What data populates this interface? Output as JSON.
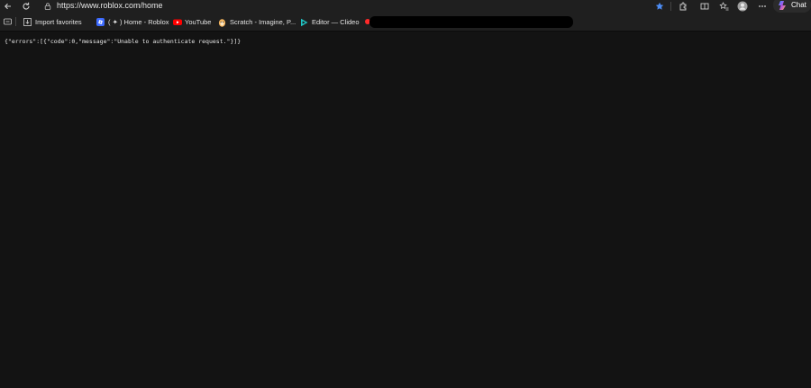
{
  "browser": {
    "address_bar": {
      "url": "https://www.roblox.com/home"
    },
    "chat_label": "Chat"
  },
  "bookmarks": {
    "items": [
      {
        "label": "Import favorites",
        "icon": "folder-import-icon"
      },
      {
        "label": "( ✦ ) Home - Roblox",
        "icon": "roblox-icon"
      },
      {
        "label": "YouTube",
        "icon": "youtube-icon"
      },
      {
        "label": "Scratch - Imagine, P...",
        "icon": "scratch-icon"
      },
      {
        "label": "Editor — Clideo",
        "icon": "clideo-icon"
      }
    ]
  },
  "page": {
    "body_text": "{\"errors\":[{\"code\":0,\"message\":\"Unable to authenticate request.\"}]}"
  }
}
